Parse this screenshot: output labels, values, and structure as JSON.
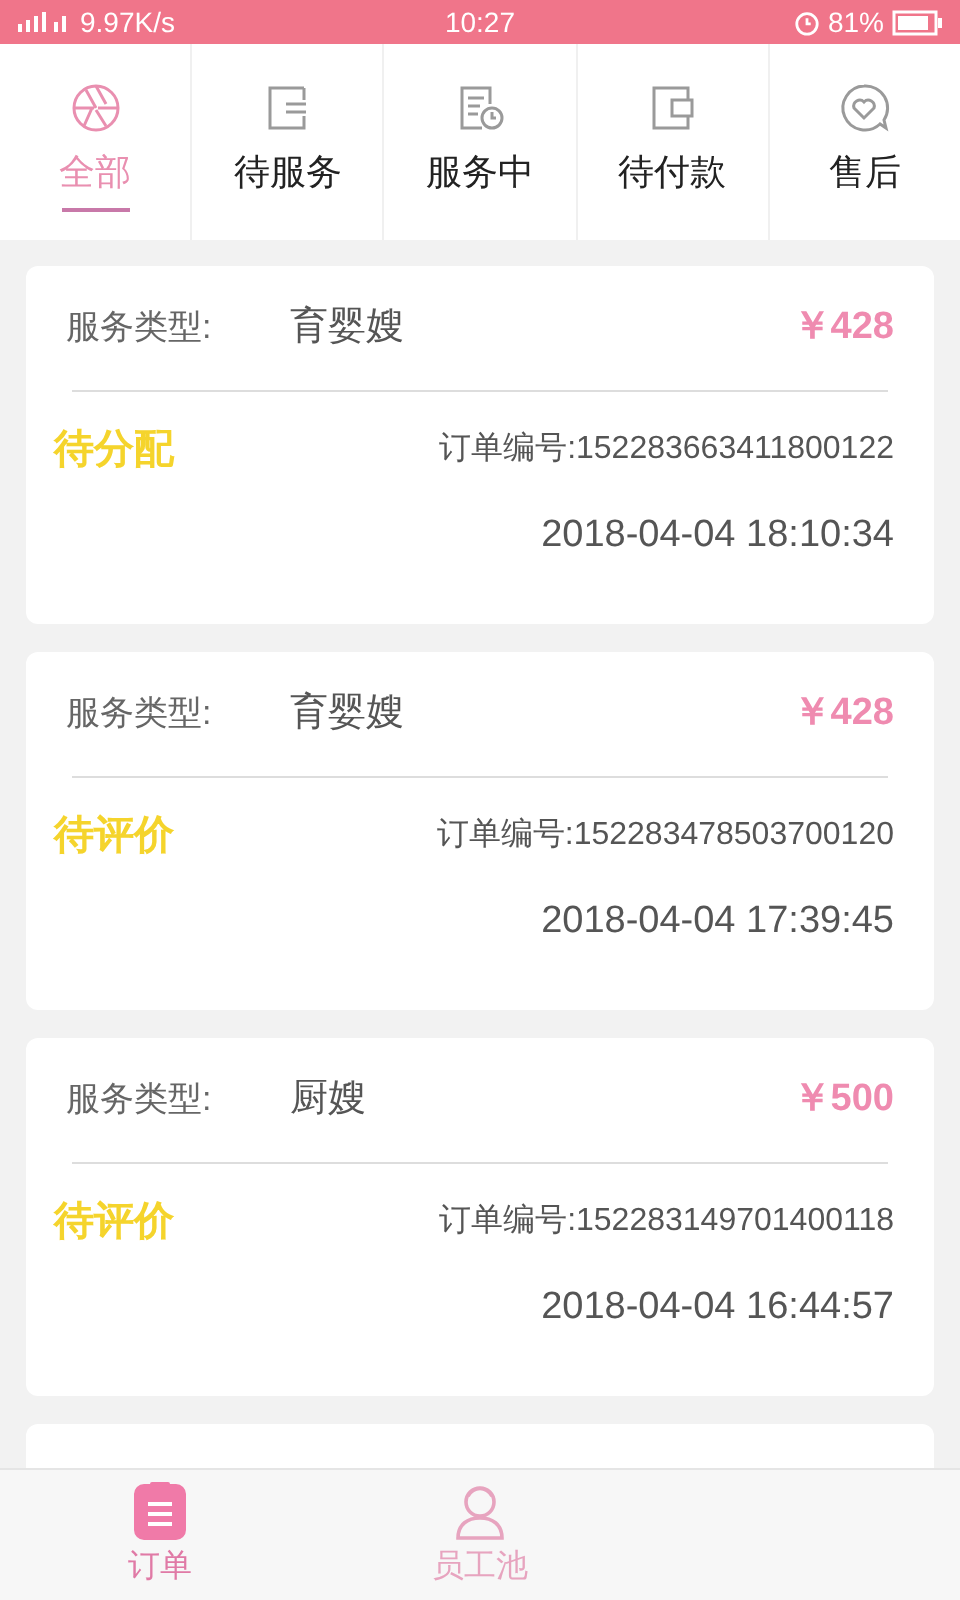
{
  "status_bar": {
    "network": "9.97K/s",
    "time": "10:27",
    "battery": "81%"
  },
  "tabs": [
    {
      "label": "全部",
      "kind": "aperture",
      "selected": true
    },
    {
      "label": "待服务",
      "kind": "wallet",
      "selected": false
    },
    {
      "label": "服务中",
      "kind": "document",
      "selected": false
    },
    {
      "label": "待付款",
      "kind": "purse",
      "selected": false
    },
    {
      "label": "售后",
      "kind": "chat",
      "selected": false
    }
  ],
  "orders": [
    {
      "type_label": "服务类型:",
      "service": "育婴嫂",
      "price": "￥428",
      "status": "待分配",
      "order_no": "订单编号:152283663411800122",
      "time": "2018-04-04 18:10:34"
    },
    {
      "type_label": "服务类型:",
      "service": "育婴嫂",
      "price": "￥428",
      "status": "待评价",
      "order_no": "订单编号:152283478503700120",
      "time": "2018-04-04 17:39:45"
    },
    {
      "type_label": "服务类型:",
      "service": "厨嫂",
      "price": "￥500",
      "status": "待评价",
      "order_no": "订单编号:152283149701400118",
      "time": "2018-04-04 16:44:57"
    }
  ],
  "bottom_nav": [
    {
      "label": "订单",
      "kind": "clipboard",
      "selected": true
    },
    {
      "label": "员工池",
      "kind": "person",
      "selected": false
    }
  ]
}
